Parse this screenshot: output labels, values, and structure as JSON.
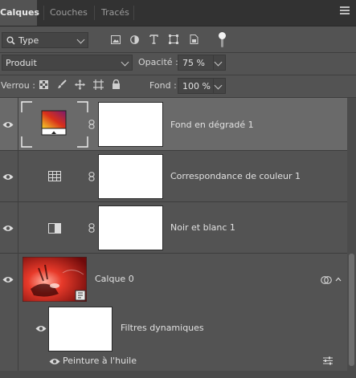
{
  "tabs": [
    {
      "label": "Calques"
    },
    {
      "label": "Couches"
    },
    {
      "label": "Tracés"
    }
  ],
  "filter": {
    "kind_value": "Type"
  },
  "blend": {
    "mode_value": "Produit",
    "opacity_label": "Opacité :",
    "opacity_value": "75 %"
  },
  "lock": {
    "label": "Verrou :",
    "fill_label": "Fond :",
    "fill_value": "100 %"
  },
  "layers": [
    {
      "name": "Fond en dégradé 1",
      "selected": true
    },
    {
      "name": "Correspondance de couleur 1"
    },
    {
      "name": "Noir et blanc 1"
    },
    {
      "name": "Calque 0"
    }
  ],
  "smart_filters": {
    "label": "Filtres dynamiques",
    "items": [
      {
        "name": "Peinture à l'huile"
      }
    ]
  },
  "colors": {
    "panel_bg": "#535353",
    "tab_bar_bg": "#323232",
    "selected_row": "#6a6a6a",
    "accent_gradient": [
      "#f5d22a",
      "#d9301a",
      "#7a1a6e"
    ]
  }
}
